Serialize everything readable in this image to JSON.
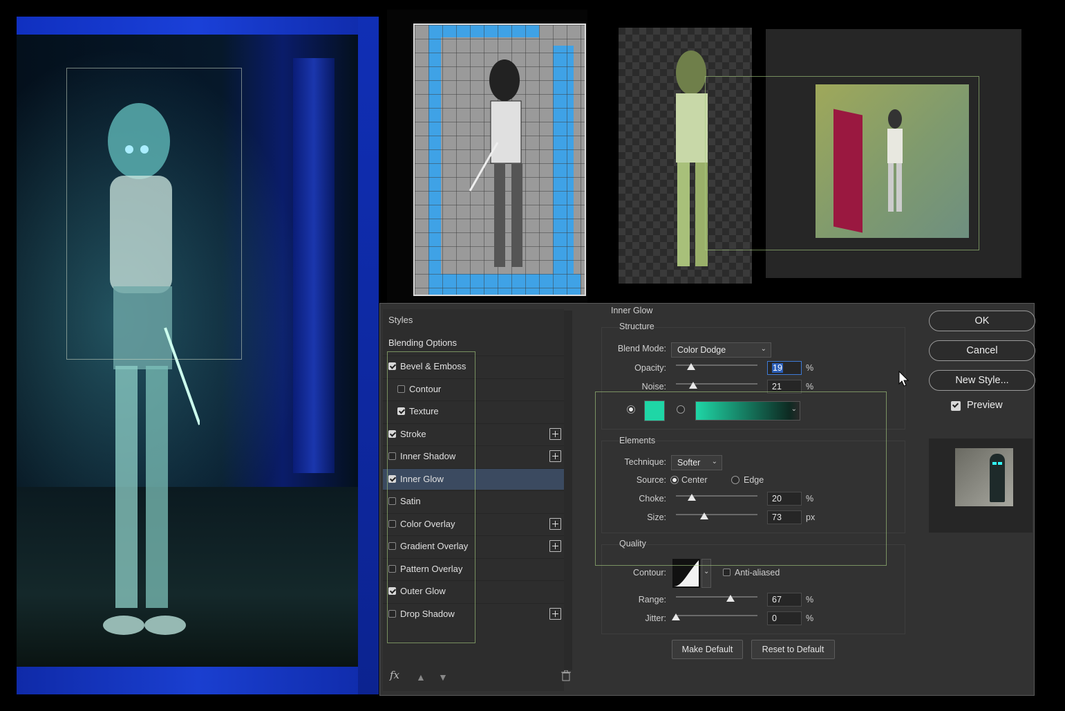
{
  "dialog": {
    "panel_header": "Inner Glow",
    "styles_title": "Styles",
    "blending_options": "Blending Options",
    "style_items": [
      {
        "label": "Bevel & Emboss",
        "checked": true,
        "indent": false,
        "plus": false
      },
      {
        "label": "Contour",
        "checked": false,
        "indent": true,
        "plus": false
      },
      {
        "label": "Texture",
        "checked": true,
        "indent": true,
        "plus": false
      },
      {
        "label": "Stroke",
        "checked": true,
        "indent": false,
        "plus": true
      },
      {
        "label": "Inner Shadow",
        "checked": false,
        "indent": false,
        "plus": true
      },
      {
        "label": "Inner Glow",
        "checked": true,
        "indent": false,
        "plus": false,
        "active": true
      },
      {
        "label": "Satin",
        "checked": false,
        "indent": false,
        "plus": false
      },
      {
        "label": "Color Overlay",
        "checked": false,
        "indent": false,
        "plus": true
      },
      {
        "label": "Gradient Overlay",
        "checked": false,
        "indent": false,
        "plus": true
      },
      {
        "label": "Pattern Overlay",
        "checked": false,
        "indent": false,
        "plus": false
      },
      {
        "label": "Outer Glow",
        "checked": true,
        "indent": false,
        "plus": false
      },
      {
        "label": "Drop Shadow",
        "checked": false,
        "indent": false,
        "plus": true
      }
    ],
    "fx_label": "fx",
    "structure": {
      "title": "Structure",
      "blend_mode_label": "Blend Mode:",
      "blend_mode_value": "Color Dodge",
      "opacity_label": "Opacity:",
      "opacity_value": "19",
      "opacity_unit": "%",
      "noise_label": "Noise:",
      "noise_value": "21",
      "noise_unit": "%",
      "glow_color": "#1fd6a6"
    },
    "elements": {
      "title": "Elements",
      "technique_label": "Technique:",
      "technique_value": "Softer",
      "source_label": "Source:",
      "source_center": "Center",
      "source_edge": "Edge",
      "choke_label": "Choke:",
      "choke_value": "20",
      "choke_unit": "%",
      "size_label": "Size:",
      "size_value": "73",
      "size_unit": "px"
    },
    "quality": {
      "title": "Quality",
      "contour_label": "Contour:",
      "anti_aliased": "Anti-aliased",
      "range_label": "Range:",
      "range_value": "67",
      "range_unit": "%",
      "jitter_label": "Jitter:",
      "jitter_value": "0",
      "jitter_unit": "%"
    },
    "make_default": "Make Default",
    "reset_default": "Reset to Default",
    "ok": "OK",
    "cancel": "Cancel",
    "new_style": "New Style...",
    "preview": "Preview"
  },
  "colors": {
    "active_row": "#3b4a60",
    "glow_color": "#1fd6a6",
    "frame_blue": "#1a40d8"
  }
}
